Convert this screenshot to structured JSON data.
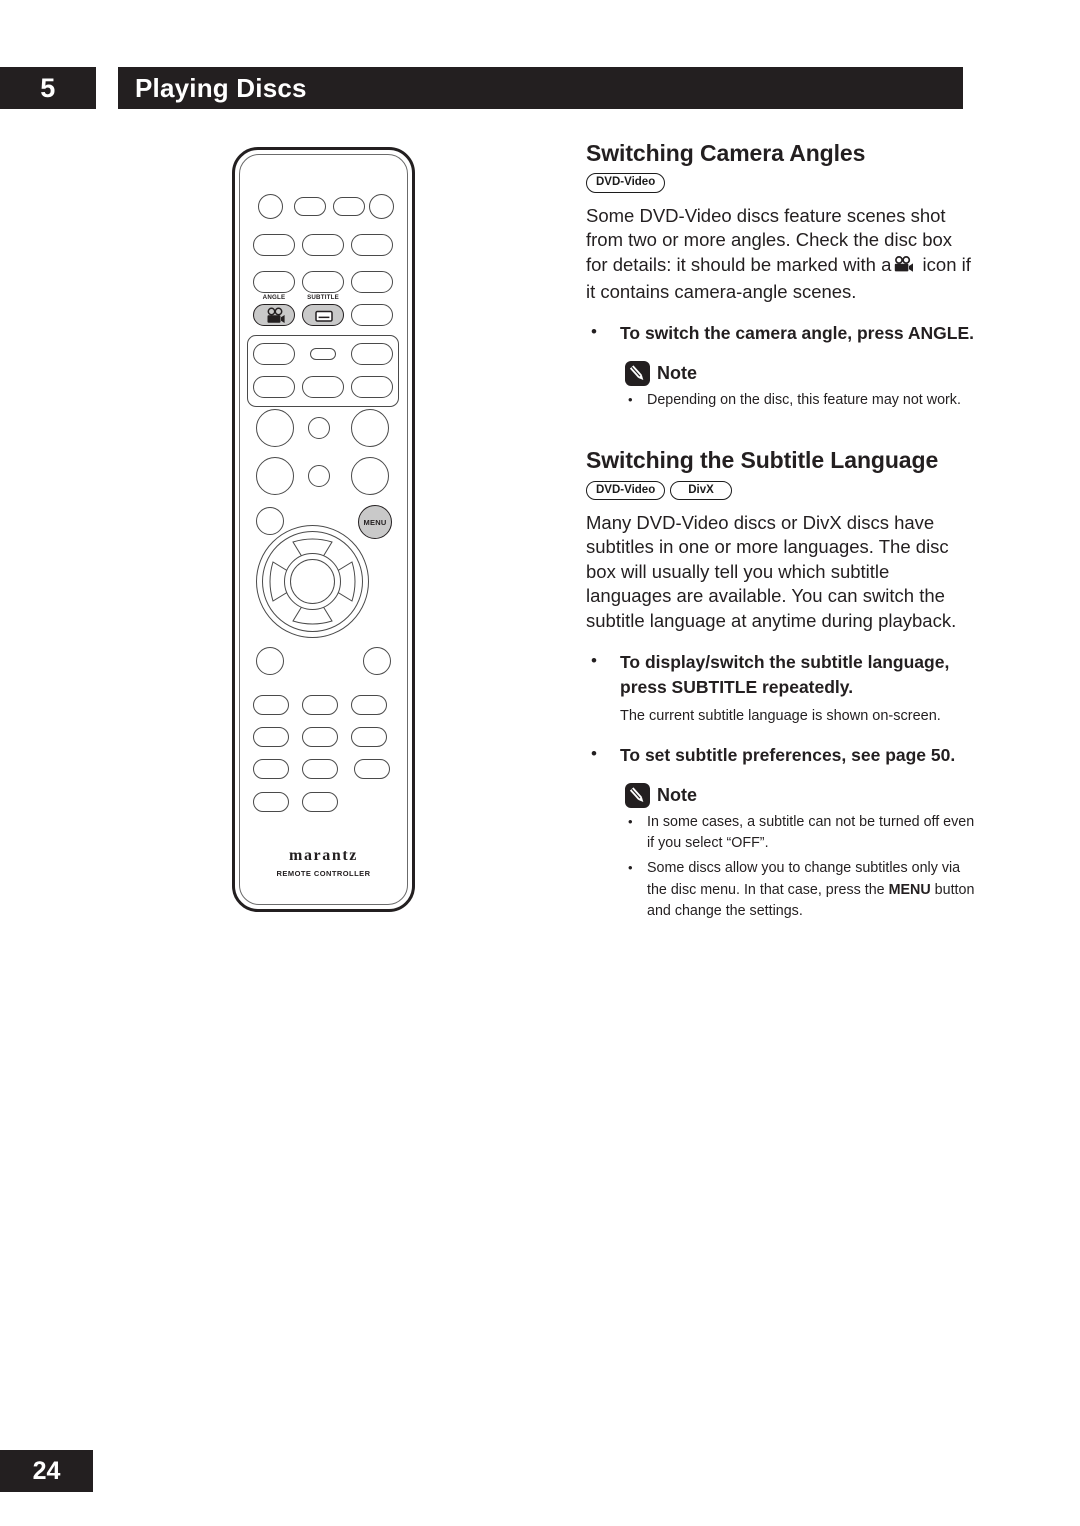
{
  "header": {
    "chapter_number": "5",
    "title": "Playing Discs"
  },
  "footer": {
    "page_number": "24"
  },
  "remote": {
    "brand": "marantz",
    "brand_subtitle": "REMOTE CONTROLLER",
    "labels": {
      "angle": "ANGLE",
      "subtitle": "SUBTITLE",
      "menu": "MENU"
    },
    "icons": {
      "angle_icon": "movie-camera-icon",
      "subtitle_icon": "caption-box-icon"
    }
  },
  "sections": [
    {
      "heading": "Switching Camera Angles",
      "badges": [
        "DVD-Video"
      ],
      "body": "Some DVD-Video discs feature scenes shot from two or more angles. Check the disc box for details: it should be marked with a",
      "body_after_icon": "icon if it contains camera-angle scenes.",
      "bullets": [
        {
          "dot": "•",
          "strong": "To switch the camera angle, press ANGLE."
        }
      ],
      "note": {
        "title": "Note",
        "items": [
          {
            "dot": "•",
            "text": "Depending on the disc, this feature may not work."
          }
        ]
      }
    },
    {
      "heading": "Switching the Subtitle Language",
      "badges": [
        "DVD-Video",
        "DivX"
      ],
      "body": "Many DVD-Video discs or DivX discs have subtitles in one or more languages. The disc box will usually tell you which subtitle languages are available. You can switch the subtitle language at anytime during playback.",
      "bullets": [
        {
          "dot": "•",
          "strong": "To display/switch the subtitle language, press SUBTITLE repeatedly.",
          "sub": "The current subtitle language is shown on-screen."
        },
        {
          "dot": "•",
          "strong": "To set subtitle preferences, see page 50."
        }
      ],
      "note": {
        "title": "Note",
        "items": [
          {
            "dot": "•",
            "text": "In some cases, a subtitle can not be turned off even if you select “OFF”."
          },
          {
            "dot": "•",
            "text_pre": "Some discs allow you to change subtitles only via the disc menu. In that case, press the ",
            "text_bold": "MENU",
            "text_post": " button and change the settings."
          }
        ]
      }
    }
  ],
  "colors": {
    "ink": "#231f20",
    "paper": "#ffffff",
    "button_grey": "#c9c9c9"
  }
}
